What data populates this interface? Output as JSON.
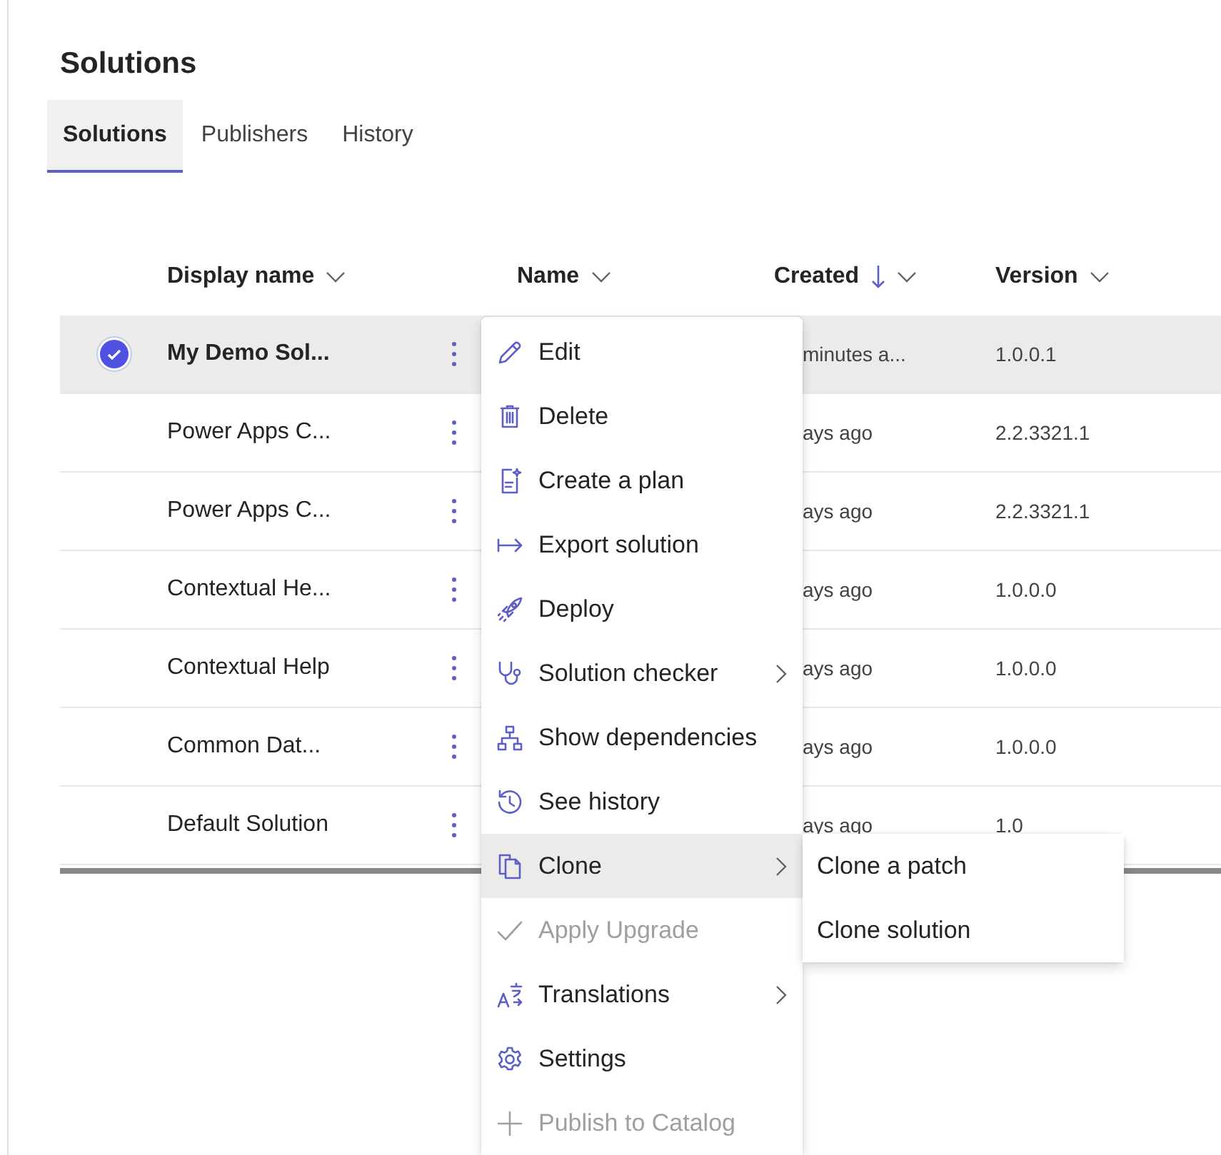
{
  "title": "Solutions",
  "tabs": [
    {
      "label": "Solutions",
      "selected": true
    },
    {
      "label": "Publishers",
      "selected": false
    },
    {
      "label": "History",
      "selected": false
    }
  ],
  "columns": [
    {
      "label": "Display name",
      "sorted": false
    },
    {
      "label": "Name",
      "sorted": false
    },
    {
      "label": "Created",
      "sorted": true
    },
    {
      "label": "Version",
      "sorted": false
    }
  ],
  "rows": [
    {
      "selected": true,
      "display_name": "My Demo Sol...",
      "created": "minutes a...",
      "version": "1.0.0.1"
    },
    {
      "selected": false,
      "display_name": "Power Apps C...",
      "created": "ays ago",
      "version": "2.2.3321.1"
    },
    {
      "selected": false,
      "display_name": "Power Apps C...",
      "created": "ays ago",
      "version": "2.2.3321.1"
    },
    {
      "selected": false,
      "display_name": "Contextual He...",
      "created": "ays ago",
      "version": "1.0.0.0"
    },
    {
      "selected": false,
      "display_name": "Contextual Help",
      "created": "ays ago",
      "version": "1.0.0.0"
    },
    {
      "selected": false,
      "display_name": "Common Dat...",
      "created": "ays ago",
      "version": "1.0.0.0"
    },
    {
      "selected": false,
      "display_name": "Default Solution",
      "created": "ays ago",
      "version": "1.0"
    }
  ],
  "context_menu": [
    {
      "label": "Edit",
      "kind": "action",
      "disabled": false
    },
    {
      "label": "Delete",
      "kind": "action",
      "disabled": false
    },
    {
      "label": "Create a plan",
      "kind": "action",
      "disabled": false
    },
    {
      "label": "Export solution",
      "kind": "action",
      "disabled": false
    },
    {
      "label": "Deploy",
      "kind": "action",
      "disabled": false
    },
    {
      "label": "Solution checker",
      "kind": "submenu",
      "disabled": false,
      "expanded": false
    },
    {
      "label": "Show dependencies",
      "kind": "action",
      "disabled": false
    },
    {
      "label": "See history",
      "kind": "action",
      "disabled": false
    },
    {
      "label": "Clone",
      "kind": "submenu",
      "disabled": false,
      "expanded": true
    },
    {
      "label": "Apply Upgrade",
      "kind": "action",
      "disabled": true
    },
    {
      "label": "Translations",
      "kind": "submenu",
      "disabled": false,
      "expanded": false
    },
    {
      "label": "Settings",
      "kind": "action",
      "disabled": false
    },
    {
      "label": "Publish to Catalog",
      "kind": "action",
      "disabled": true
    }
  ],
  "submenu": [
    {
      "label": "Clone a patch"
    },
    {
      "label": "Clone solution"
    }
  ]
}
